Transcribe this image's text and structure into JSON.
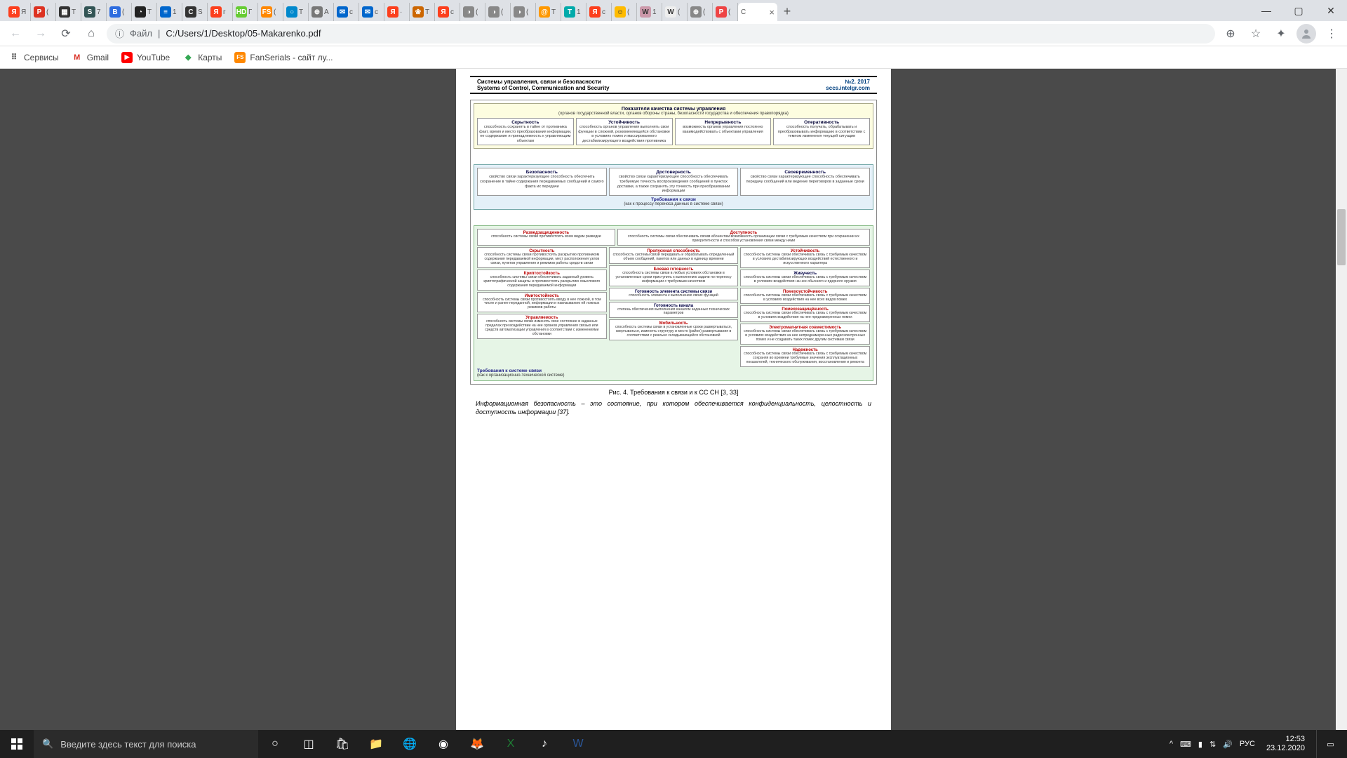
{
  "window": {
    "minimize": "—",
    "maximize": "▢",
    "close": "✕"
  },
  "tabs": [
    {
      "favicon": "Я",
      "bg": "#fc3f1d",
      "color": "#fff",
      "label": "Я"
    },
    {
      "favicon": "P",
      "bg": "#d32",
      "color": "#fff",
      "label": "("
    },
    {
      "favicon": "▦",
      "bg": "#333",
      "color": "#fff",
      "label": "Т"
    },
    {
      "favicon": "S",
      "bg": "#355",
      "color": "#fff",
      "label": "7"
    },
    {
      "favicon": "B",
      "bg": "#2d6",
      "color": "#fff",
      "label": "("
    },
    {
      "favicon": "◔",
      "bg": "#222",
      "color": "#fff",
      "label": "Т"
    },
    {
      "favicon": "≡",
      "bg": "#06c",
      "color": "#fff",
      "label": "1"
    },
    {
      "favicon": "C",
      "bg": "#333",
      "color": "#fff",
      "label": "S"
    },
    {
      "favicon": "Я",
      "bg": "#fc3f1d",
      "color": "#fff",
      "label": "г"
    },
    {
      "favicon": "HD",
      "bg": "#6c3",
      "color": "#fff",
      "label": "Г"
    },
    {
      "favicon": "FS",
      "bg": "#f80",
      "color": "#fff",
      "label": "("
    },
    {
      "favicon": "○",
      "bg": "#08c",
      "color": "#fff",
      "label": "Т"
    },
    {
      "favicon": "⊕",
      "bg": "#777",
      "color": "#fff",
      "label": "А"
    },
    {
      "favicon": "✉",
      "bg": "#06c",
      "color": "#fff",
      "label": "с"
    },
    {
      "favicon": "✉",
      "bg": "#06c",
      "color": "#fff",
      "label": "с"
    },
    {
      "favicon": "Я",
      "bg": "#fc3f1d",
      "color": "#fff",
      "label": "·"
    },
    {
      "favicon": "❀",
      "bg": "#c60",
      "color": "#fff",
      "label": "Т"
    },
    {
      "favicon": "Я",
      "bg": "#fc3f1d",
      "color": "#fff",
      "label": "с"
    },
    {
      "favicon": "◑",
      "bg": "#888",
      "color": "#fff",
      "label": "("
    },
    {
      "favicon": "◑",
      "bg": "#888",
      "color": "#fff",
      "label": "("
    },
    {
      "favicon": "◑",
      "bg": "#888",
      "color": "#fff",
      "label": "("
    },
    {
      "favicon": "@",
      "bg": "#f90",
      "color": "#fff",
      "label": "Т"
    },
    {
      "favicon": "T",
      "bg": "#0aa",
      "color": "#fff",
      "label": "1"
    },
    {
      "favicon": "Я",
      "bg": "#fc3f1d",
      "color": "#fff",
      "label": "с"
    },
    {
      "favicon": "☺",
      "bg": "#fb0",
      "color": "#333",
      "label": "("
    },
    {
      "favicon": "W",
      "bg": "#c9a",
      "color": "#333",
      "label": "1"
    },
    {
      "favicon": "W",
      "bg": "#eee",
      "color": "#333",
      "label": "("
    },
    {
      "favicon": "⊕",
      "bg": "#888",
      "color": "#fff",
      "label": "("
    },
    {
      "favicon": "P",
      "bg": "#e44",
      "color": "#fff",
      "label": "("
    }
  ],
  "active_tab": {
    "label": "C",
    "close": "×"
  },
  "new_tab": "+",
  "nav": {
    "back": "←",
    "forward": "→",
    "reload": "⟳",
    "home": "⌂"
  },
  "address": {
    "scheme_icon": "ⓘ",
    "scheme": "Файл",
    "sep": "|",
    "path": "C:/Users/1/Desktop/05-Makarenko.pdf"
  },
  "tb_right": {
    "zoom": "⊕",
    "star": "☆",
    "ext": "✦",
    "menu": "⋮"
  },
  "bookmarks": [
    {
      "icon": "⠿",
      "bg": "",
      "color": "#5f6368",
      "label": "Сервисы"
    },
    {
      "icon": "M",
      "bg": "",
      "color": "#d93025",
      "label": "Gmail"
    },
    {
      "icon": "▶",
      "bg": "#f00",
      "color": "#fff",
      "label": "YouTube"
    },
    {
      "icon": "◆",
      "bg": "",
      "color": "#34a853",
      "label": "Карты"
    },
    {
      "icon": "FS",
      "bg": "#f80",
      "color": "#fff",
      "label": "FanSerials - сайт лу..."
    }
  ],
  "pdf": {
    "header": {
      "ru": "Системы управления, связи и безопасности",
      "en": "Systems of Control, Communication and Security",
      "issue": "№2. 2017",
      "site": "sccs.intelgr.com"
    },
    "top_block": {
      "title": "Показатели качества системы управления",
      "subtitle": "(органов государственной власти, органов обороны страны, безопасности государства и обеспечения правопорядка)",
      "items": [
        {
          "t": "Скрытность",
          "d": "способность сохранять в тайне от противника факт, время и место преобразования информации, ее содержание и принадлежность к управляющим объектам"
        },
        {
          "t": "Устойчивость",
          "d": "способность органов управления выполнять свои функции в сложной, резкоменяющейся обстановке в условиях помех и массированного дестабилизирующего воздействия противника"
        },
        {
          "t": "Непрерывность",
          "d": "возможность органов управления постоянно взаимодействовать с объектами управления"
        },
        {
          "t": "Оперативность",
          "d": "способность получать, обрабатывать и преобразовывать информацию в соответствии с темпом изменения текущей ситуации"
        }
      ]
    },
    "blue_block": {
      "items": [
        {
          "t": "Безопасность",
          "d": "свойство связи характеризующее способность обеспечить сохранение в тайне содержания передаваемых сообщений и самого факта их передачи"
        },
        {
          "t": "Достоверность",
          "d": "свойство связи характеризующее способность обеспечивать требуемую точность воспроизведения сообщений в пунктах доставки, а также сохранять эту точность при преобразовании информации"
        },
        {
          "t": "Своевременность",
          "d": "свойство связи характеризующее способность обеспечивать передачу сообщений или ведение переговоров в заданные сроки"
        }
      ],
      "req_t": "Требования к связи",
      "req_d": "(как к процессу переноса данных в системе связи)"
    },
    "green_block": {
      "top": [
        {
          "t": "Разведзащищенность",
          "d": "способность системы связи противостоять всем видам разведки"
        },
        {
          "t": "Доступность",
          "d": "способность системы связи обеспечивать своим абонентам возможность организации связи с требуемым качеством при сохранении их приоритетности и способов установления связи между ними"
        }
      ],
      "cols": {
        "left": [
          {
            "t": "Скрытность",
            "d": "способность системы связи противостоять раскрытию противником содержания передаваемой информации, мест расположения узлов связи, пунктов управления и режимов работы средств связи"
          },
          {
            "t": "Криптостойкость",
            "d": "способность системы связи обеспечивать заданный уровень криптографической защиты и противостоять раскрытию смыслового содержания передаваемой информации"
          },
          {
            "t": "Имитостойкость",
            "d": "способность системы связи противостоять вводу в нее ложной, в том числе и ранее переданной, информации и навязыванию ей ложных режимов работы"
          },
          {
            "t": "Управляемость",
            "d": "способность системы связи изменять свое состояние в заданных пределах при воздействии на нее органов управления связью или средств автоматизации управления в соответствии с изменениями обстановки"
          }
        ],
        "mid": [
          {
            "t": "Пропускная способность",
            "d": "способность системы связи передавать и обрабатывать определенный объем сообщений, пакетов или данных в единицу времени"
          },
          {
            "t": "Боевая готовность",
            "d": "способность системы связи в любых условиях обстановки в установленные сроки приступить к выполнению задачи по переносу информации с требуемым качеством"
          },
          {
            "t": "Готовность элемента системы связи",
            "d": "способность элемента к выполнению своих функций"
          },
          {
            "t": "Готовность канала",
            "d": "степень обеспечения выполнения каналом заданных технических параметров"
          },
          {
            "t": "Мобильность",
            "d": "способность системы связи в установленные сроки развертываться, свертываться, изменять структуру и место (район) развертывания в соответствии с реально складывающейся обстановкой"
          }
        ],
        "right": [
          {
            "t": "Устойчивость",
            "d": "способность системы связи обеспечивать связь с требуемым качеством в условиях дестабилизирующих воздействий естественного и искусственного характера"
          },
          {
            "t": "Живучесть",
            "d": "способность системы связи обеспечивать связь с требуемым качеством в условиях воздействия на нее обычного и ядерного оружия"
          },
          {
            "t": "Помехоустойчивость",
            "d": "способность системы связи обеспечивать связь с требуемым качеством в условиях воздействия на нее всех видов помех"
          },
          {
            "t": "Помехозащищённость",
            "d": "способность системы связи обеспечивать связь с требуемым качеством в условиях воздействия на нее преднамеренных помех"
          },
          {
            "t": "Электромагнитная совместимость",
            "d": "способность системы связи обеспечивать связь с требуемым качеством в условиях воздействия на нее непреднамеренных радиоэлектронных помех и не создавать таких помех другим системам связи"
          },
          {
            "t": "Надежность",
            "d": "способность системы связи обеспечивать связь с требуемым качеством сохраняя во времени требуемые значения эксплуатационных показателей, технического обслуживания, восстановления и ремонта"
          }
        ]
      },
      "req_t": "Требования к системе связи",
      "req_d": "(как к организационно-технической системе)"
    },
    "caption": "Рис. 4. Требования к связи и к СС СН [3, 33]",
    "body": "Информационная безопасность – это состояние, при котором обеспечивается конфиденциальность, целостность и доступность информации [37]."
  },
  "taskbar": {
    "search_placeholder": "Введите здесь текст для поиска",
    "tray": {
      "chevron": "^",
      "input": "⌨",
      "battery": "▮",
      "wifi": "⇅",
      "volume": "🔊",
      "lang": "РУС",
      "time": "12:53",
      "date": "23.12.2020",
      "notif": "▭"
    }
  }
}
